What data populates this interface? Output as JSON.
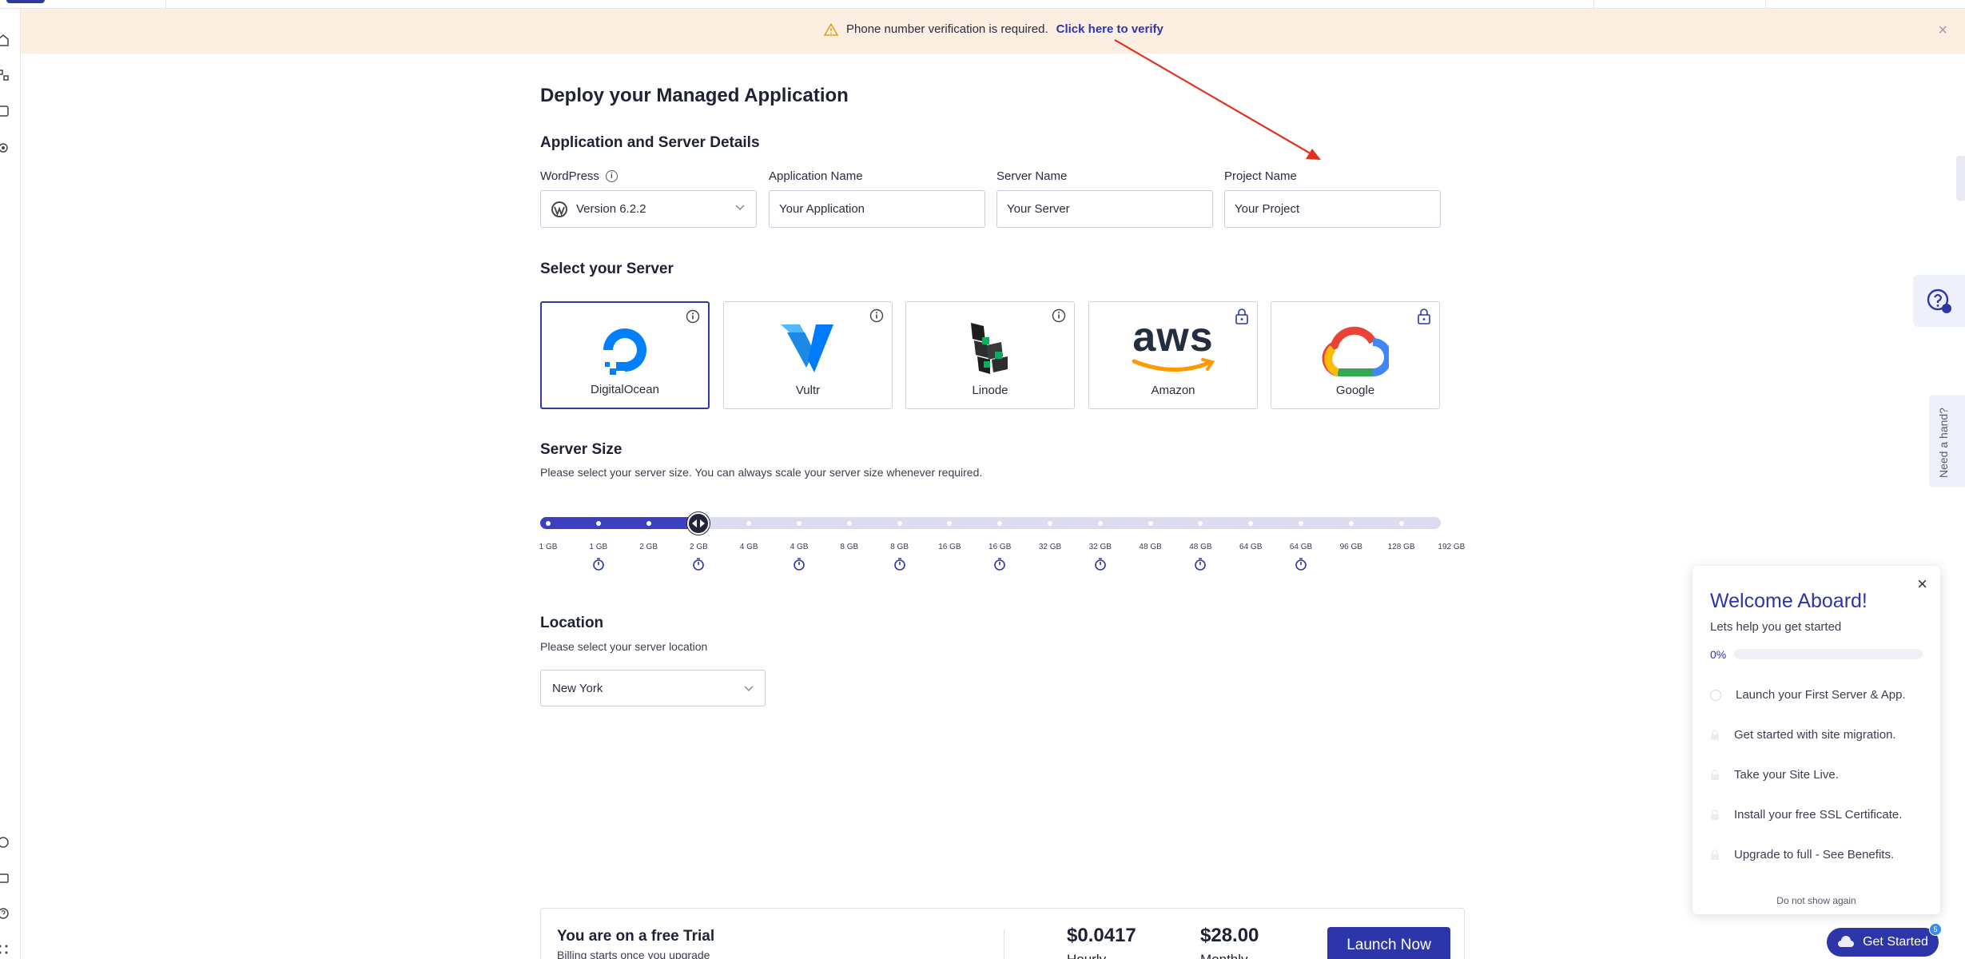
{
  "banner": {
    "message": "Phone number verification is required.",
    "link": "Click here to verify",
    "close": "×"
  },
  "page": {
    "title": "Deploy your Managed Application"
  },
  "details": {
    "section_title": "Application and Server Details",
    "fields": [
      {
        "label": "WordPress",
        "value": "Version 6.2.2"
      },
      {
        "label": "Application Name",
        "placeholder": "Your Application"
      },
      {
        "label": "Server Name",
        "placeholder": "Your Server"
      },
      {
        "label": "Project Name",
        "placeholder": "Your Project"
      }
    ]
  },
  "servers": {
    "section_title": "Select your Server",
    "providers": [
      {
        "name": "DigitalOcean",
        "selected": true,
        "corner": "info-icon"
      },
      {
        "name": "Vultr",
        "selected": false,
        "corner": "info-icon"
      },
      {
        "name": "Linode",
        "selected": false,
        "corner": "info-icon"
      },
      {
        "name": "Amazon",
        "selected": false,
        "corner": "lock-icon",
        "logo_text": "aws"
      },
      {
        "name": "Google",
        "selected": false,
        "corner": "lock-icon"
      }
    ]
  },
  "size": {
    "section_title": "Server Size",
    "subtitle": "Please select your server size. You can always scale your server size whenever required.",
    "selected_index": 3,
    "ticks": [
      "1 GB",
      "1 GB",
      "2 GB",
      "2 GB",
      "4 GB",
      "4 GB",
      "8 GB",
      "8 GB",
      "16 GB",
      "16 GB",
      "32 GB",
      "32 GB",
      "48 GB",
      "48 GB",
      "64 GB",
      "64 GB",
      "96 GB",
      "128 GB",
      "192 GB"
    ],
    "timer_indices": [
      1,
      3,
      5,
      7,
      9,
      11,
      13,
      15
    ]
  },
  "location": {
    "section_title": "Location",
    "subtitle": "Please select your server location",
    "value": "New York"
  },
  "footer": {
    "trial_title": "You are on a free Trial",
    "trial_sub": "Billing starts once you upgrade",
    "hourly_price": "$0.0417",
    "hourly_label": "Hourly",
    "monthly_price": "$28.00",
    "monthly_label": "Monthly",
    "launch_label": "Launch Now"
  },
  "side": {
    "need_hand": "Need a hand?"
  },
  "welcome": {
    "title": "Welcome Aboard!",
    "subtitle": "Lets help you get started",
    "progress_label": "0%",
    "progress": 0,
    "steps": [
      "Launch your First Server & App.",
      "Get started with site migration.",
      "Take your Site Live.",
      "Install your free SSL Certificate.",
      "Upgrade to full - See Benefits."
    ],
    "no_show": "Do not show again",
    "close": "×"
  },
  "get_started": {
    "label": "Get Started",
    "badge": "5"
  },
  "colors": {
    "primary": "#2d36a8",
    "banner_bg": "#fdeee2",
    "track": "#dcdcf0",
    "track_fill": "#3b3fc0"
  }
}
